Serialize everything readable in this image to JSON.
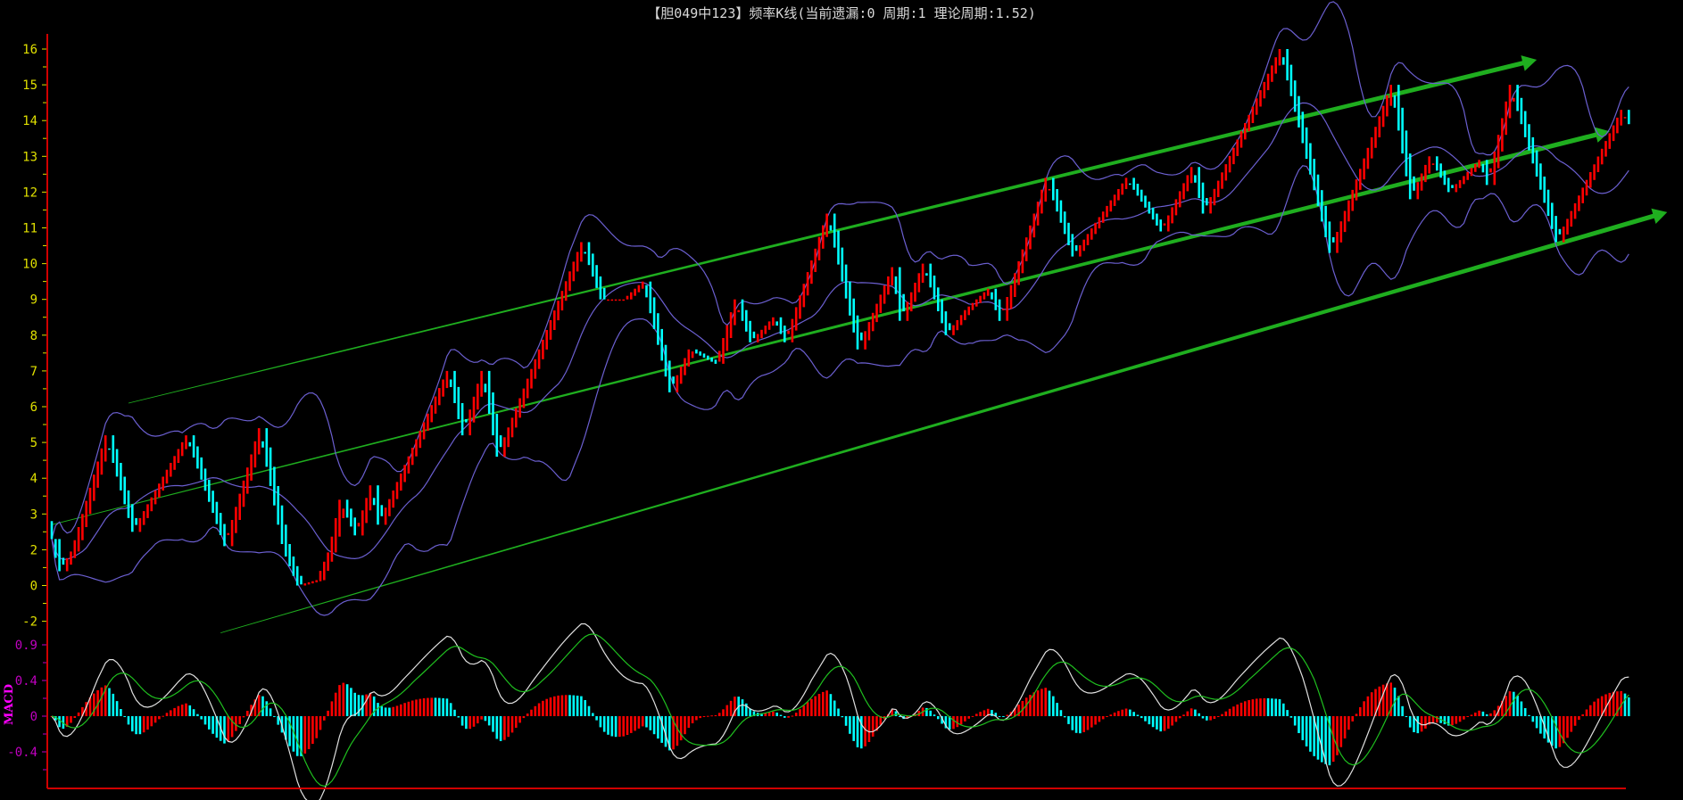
{
  "title": "【胆049中123】频率K线(当前遗漏:0 周期:1 理论周期:1.52)",
  "chart_data": {
    "type": "candlestick",
    "title": "【胆049中123】频率K线(当前遗漏:0 周期:1 理论周期:1.52)",
    "candle_count": 412,
    "price_axis": {
      "ticks": [
        "16",
        "15",
        "14",
        "13",
        "12",
        "11",
        "10",
        "9",
        "8",
        "7",
        "6",
        "5",
        "4",
        "3",
        "2",
        "0",
        "-2"
      ]
    },
    "macd_axis": {
      "label": "MACD",
      "ticks": [
        "0.9",
        "0.4",
        "0",
        "-0.4"
      ]
    },
    "close_waypoints": [
      [
        0,
        2.3
      ],
      [
        2,
        0.8
      ],
      [
        14,
        5.2
      ],
      [
        21,
        2.5
      ],
      [
        35,
        5.2
      ],
      [
        45,
        2.1
      ],
      [
        54,
        5.4
      ],
      [
        64,
        0
      ],
      [
        69,
        0.3
      ],
      [
        75,
        3.4
      ],
      [
        79,
        2.4
      ],
      [
        83,
        3.8
      ],
      [
        85,
        2.7
      ],
      [
        103,
        7.0
      ],
      [
        107,
        5.2
      ],
      [
        112,
        7.0
      ],
      [
        116,
        4.6
      ],
      [
        138,
        10.6
      ],
      [
        143,
        9.0
      ],
      [
        149,
        9.0
      ],
      [
        154,
        9.5
      ],
      [
        161,
        6.4
      ],
      [
        166,
        7.6
      ],
      [
        173,
        7.2
      ],
      [
        178,
        9.0
      ],
      [
        182,
        7.8
      ],
      [
        188,
        8.5
      ],
      [
        191,
        7.8
      ],
      [
        202,
        11.4
      ],
      [
        210,
        7.6
      ],
      [
        219,
        9.9
      ],
      [
        221,
        8.4
      ],
      [
        227,
        10.0
      ],
      [
        233,
        8.0
      ],
      [
        238,
        8.7
      ],
      [
        244,
        9.3
      ],
      [
        247,
        8.4
      ],
      [
        259,
        12.4
      ],
      [
        266,
        10.2
      ],
      [
        280,
        12.4
      ],
      [
        286,
        11.4
      ],
      [
        289,
        10.9
      ],
      [
        297,
        12.7
      ],
      [
        300,
        11.4
      ],
      [
        320,
        16.0
      ],
      [
        333,
        10.3
      ],
      [
        349,
        15.0
      ],
      [
        354,
        11.8
      ],
      [
        359,
        13.0
      ],
      [
        364,
        12.0
      ],
      [
        372,
        12.9
      ],
      [
        374,
        12.2
      ],
      [
        380,
        15.0
      ],
      [
        392,
        10.6
      ],
      [
        409,
        14.3
      ],
      [
        411,
        13.9
      ]
    ],
    "bollinger": {
      "period": 20,
      "k": 2
    },
    "macd": {
      "fast": 12,
      "slow": 26,
      "signal": 9
    },
    "trend_lines": [
      {
        "from": [
          20,
          6.1
        ],
        "to": [
          387,
          15.7
        ]
      },
      {
        "from": [
          0,
          2.7
        ],
        "to": [
          406,
          13.7
        ]
      },
      {
        "from": [
          44,
          -2.65
        ],
        "to": [
          421,
          11.44
        ]
      }
    ],
    "colors": {
      "up": "#ff0000",
      "down": "#00ffff",
      "bollinger": "#6b5fd0",
      "trend": "#1fae1f",
      "axis": "#d00000",
      "price_tick": "#e0e000",
      "macd_tick": "#c000c0",
      "macd_label": "#ff00ff",
      "dif": "#e0e0e0",
      "dea": "#1fbf1f"
    }
  }
}
